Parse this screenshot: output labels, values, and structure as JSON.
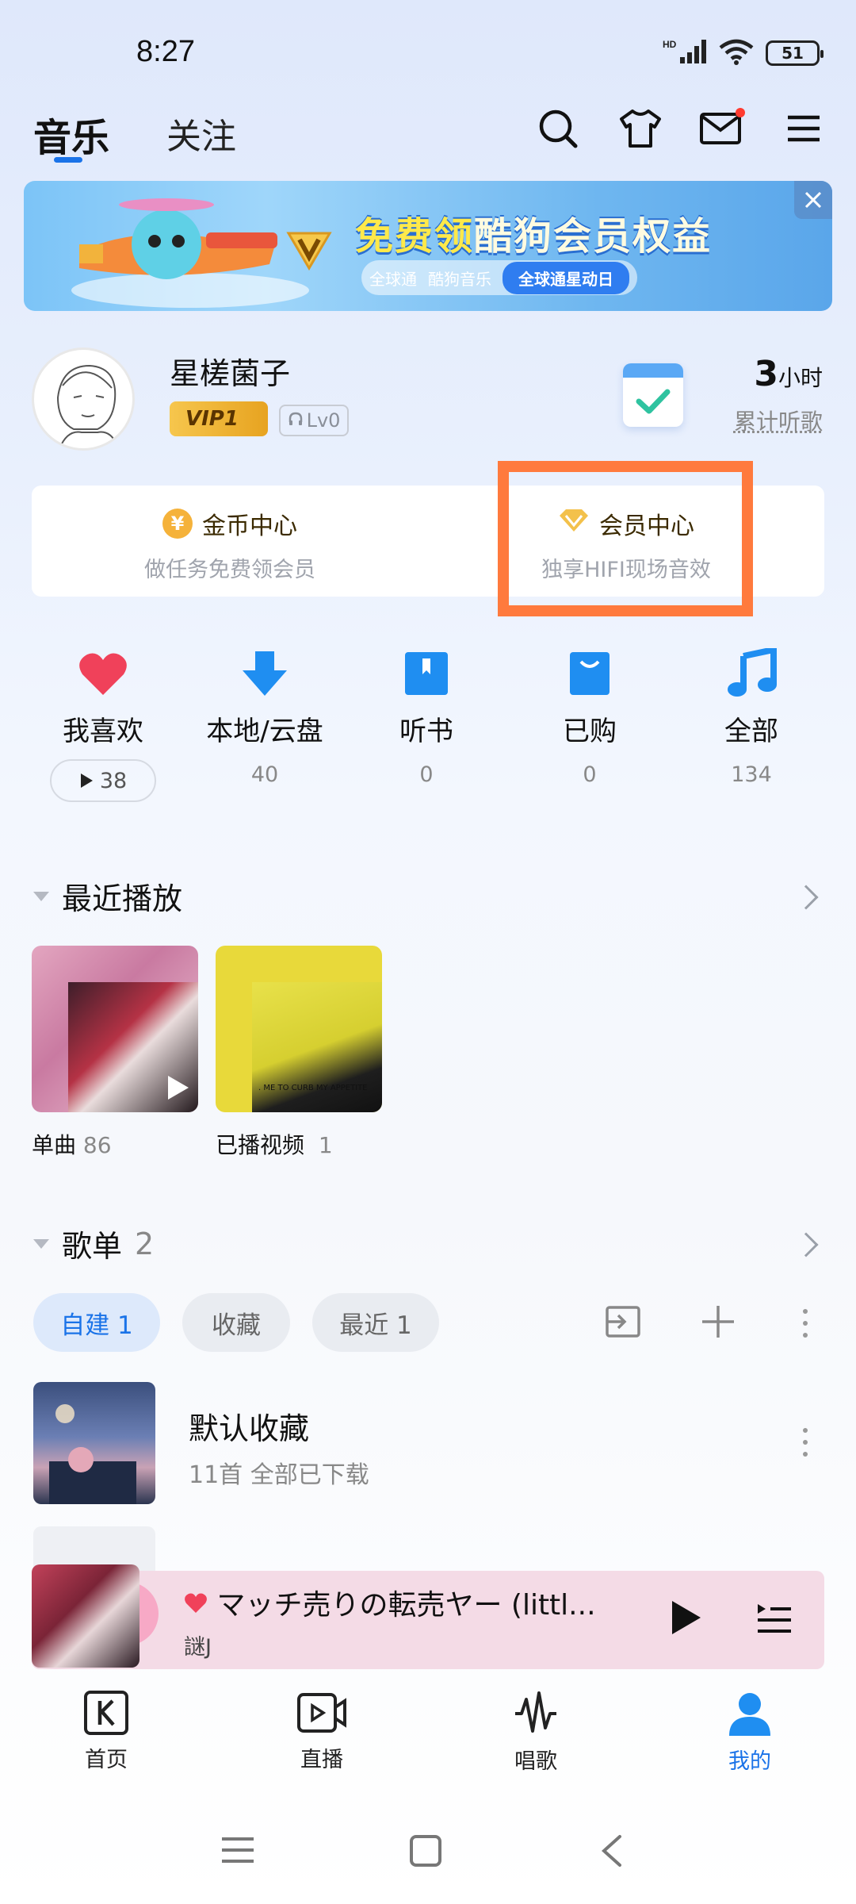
{
  "status_bar": {
    "time": "8:27",
    "network": "HD",
    "battery": "51"
  },
  "header": {
    "tabs": [
      "音乐",
      "关注"
    ]
  },
  "banner": {
    "title_highlight": "免费领",
    "title_rest": "酷狗会员权益",
    "brand_left": "全球通",
    "brand_right": "酷狗音乐",
    "chip": "全球通星动日"
  },
  "profile": {
    "username": "星槎菌子",
    "vip": "VIP1",
    "level": "Lv0",
    "listen_hours": "3",
    "listen_unit": "小时",
    "listen_label": "累计听歌"
  },
  "cards": {
    "coin": {
      "title": "金币中心",
      "subtitle": "做任务免费领会员",
      "icon_text": "¥"
    },
    "member": {
      "title": "会员中心",
      "subtitle": "独享HIFI现场音效"
    }
  },
  "entries": [
    {
      "label": "我喜欢",
      "count": "38"
    },
    {
      "label": "本地/云盘",
      "count": "40"
    },
    {
      "label": "听书",
      "count": "0"
    },
    {
      "label": "已购",
      "count": "0"
    },
    {
      "label": "全部",
      "count": "134"
    }
  ],
  "recent": {
    "title": "最近播放",
    "items": [
      {
        "label": "单曲",
        "count": "86"
      },
      {
        "label": "已播视频",
        "count": "1",
        "cover_text": ". ME TO CURB MY APPETITE"
      }
    ]
  },
  "playlists": {
    "title": "歌单",
    "count": "2",
    "chips": [
      "自建 1",
      "收藏",
      "最近 1"
    ],
    "items": [
      {
        "title": "默认收藏",
        "subtitle": "11首   全部已下载"
      }
    ]
  },
  "player": {
    "song": "マッチ売りの転売ヤー (littl...",
    "artist": "謎J"
  },
  "bottom_nav": [
    "首页",
    "直播",
    "唱歌",
    "我的"
  ],
  "colors": {
    "accent": "#1a73e8",
    "highlight_box": "#ff7a3d",
    "vip_gold": "#f6c64d",
    "player_bg": "#f4dbe6"
  }
}
